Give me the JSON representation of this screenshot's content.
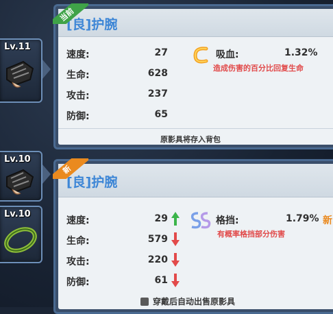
{
  "slots": [
    {
      "level": "Lv.11"
    },
    {
      "level": "Lv.10"
    },
    {
      "level": "Lv.10"
    }
  ],
  "current": {
    "badge": "当前",
    "title": "[良]护腕",
    "stats": [
      {
        "label": "速度:",
        "value": "27"
      },
      {
        "label": "生命:",
        "value": "628"
      },
      {
        "label": "攻击:",
        "value": "237"
      },
      {
        "label": "防御:",
        "value": "65"
      }
    ],
    "skill": {
      "icon_letter": "C",
      "name": "吸血:",
      "value": "1.32%",
      "desc": "造成伤害的百分比回复生命"
    },
    "footer": "原影具将存入背包"
  },
  "new": {
    "badge": "新",
    "title": "[良]护腕",
    "stats": [
      {
        "label": "速度:",
        "value": "29",
        "trend": "up"
      },
      {
        "label": "生命:",
        "value": "579",
        "trend": "down"
      },
      {
        "label": "攻击:",
        "value": "220",
        "trend": "down"
      },
      {
        "label": "防御:",
        "value": "61",
        "trend": "down"
      }
    ],
    "skill": {
      "icon_letter": "SS",
      "name": "格挡:",
      "value": "1.79%",
      "new_tag": "新",
      "desc": "有概率格挡部分伤害"
    },
    "footer": "穿戴后自动出售原影具"
  },
  "colors": {
    "up": "#3bb54a",
    "down": "#e24a4a",
    "title": "#3d86d6",
    "desc": "#e14a4a"
  }
}
